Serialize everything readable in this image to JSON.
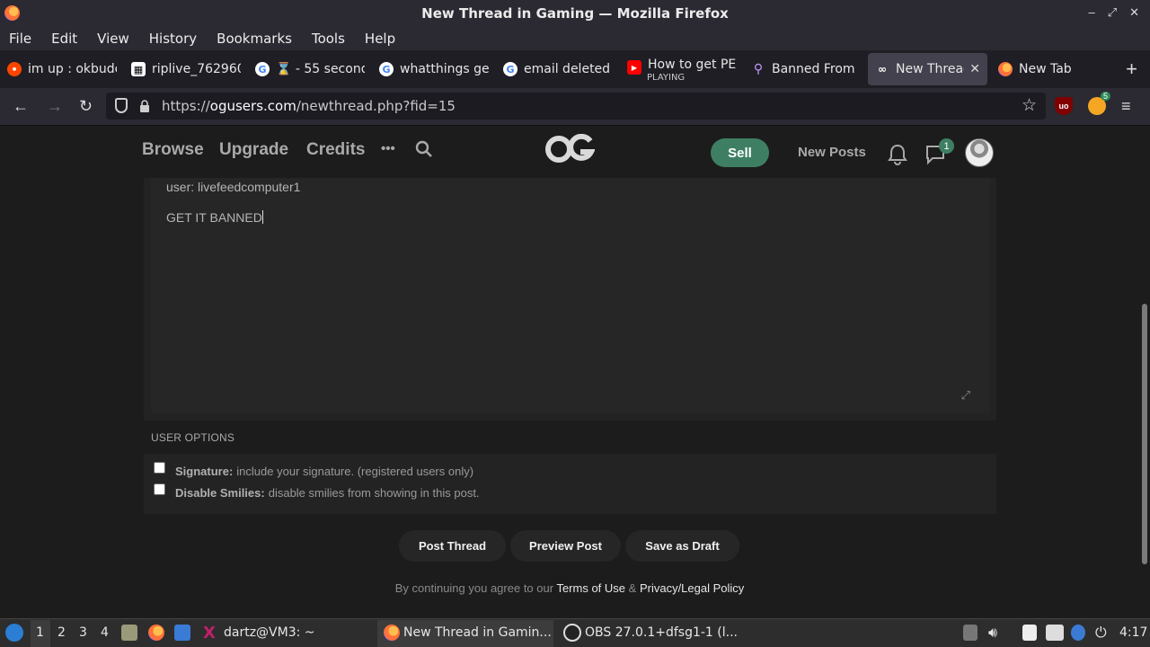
{
  "window": {
    "title": "New Thread in Gaming — Mozilla Firefox",
    "controls": [
      "–",
      "⤢",
      "✕"
    ]
  },
  "menu": [
    "File",
    "Edit",
    "View",
    "History",
    "Bookmarks",
    "Tools",
    "Help"
  ],
  "tabs": [
    {
      "label": "im up : okbudc",
      "icon": "reddit-icon",
      "color": "#ff4500"
    },
    {
      "label": "riplive_762960",
      "icon": "qr-icon",
      "color": "#ffffff"
    },
    {
      "label": "⌛ - 55 second",
      "icon": "google-icon",
      "color": "#ffffff"
    },
    {
      "label": "whatthings ge",
      "icon": "google-icon",
      "color": "#ffffff"
    },
    {
      "label": "email deleted",
      "icon": "google-icon",
      "color": "#ffffff"
    },
    {
      "label": "How to get PE",
      "sub": "PLAYING",
      "icon": "youtube-icon",
      "color": "#ff0000"
    },
    {
      "label": "Banned From",
      "icon": "link-icon",
      "color": "#c09aff"
    },
    {
      "label": "New Thread",
      "icon": "og-icon",
      "color": "#ffffff",
      "active": true
    },
    {
      "label": "New Tab",
      "icon": "firefox-icon",
      "color": "#ff7139"
    }
  ],
  "url": {
    "prefix": "https://",
    "domain": "ogusers.com",
    "path": "/newthread.php?fid=15"
  },
  "extensions": {
    "ublock_color": "#800000",
    "badge": "5"
  },
  "site": {
    "nav": [
      "Browse",
      "Upgrade",
      "Credits"
    ],
    "more": "•••",
    "logo": "OG",
    "sell": "Sell",
    "new_posts": "New Posts",
    "messages_badge": "1",
    "accent": "#3e7f63"
  },
  "editor": {
    "line1": "user: livefeedcomputer1",
    "line2": "GET IT BANNED"
  },
  "options": {
    "title": "USER OPTIONS",
    "signature_label": "Signature:",
    "signature_desc": "include your signature. (registered users only)",
    "smilies_label": "Disable Smilies:",
    "smilies_desc": "disable smilies from showing in this post."
  },
  "buttons": {
    "post": "Post Thread",
    "preview": "Preview Post",
    "draft": "Save as Draft"
  },
  "agreement": {
    "pre": "By continuing you agree to our",
    "terms": "Terms of Use",
    "amp": "&",
    "privacy": "Privacy/Legal Policy"
  },
  "taskbar": {
    "workspaces": [
      "1",
      "2",
      "3",
      "4"
    ],
    "apps": [
      "dartz@VM3: ~",
      "New Thread in Gamin...",
      "OBS 27.0.1+dfsg1-1 (l..."
    ],
    "clock": "4:17"
  }
}
